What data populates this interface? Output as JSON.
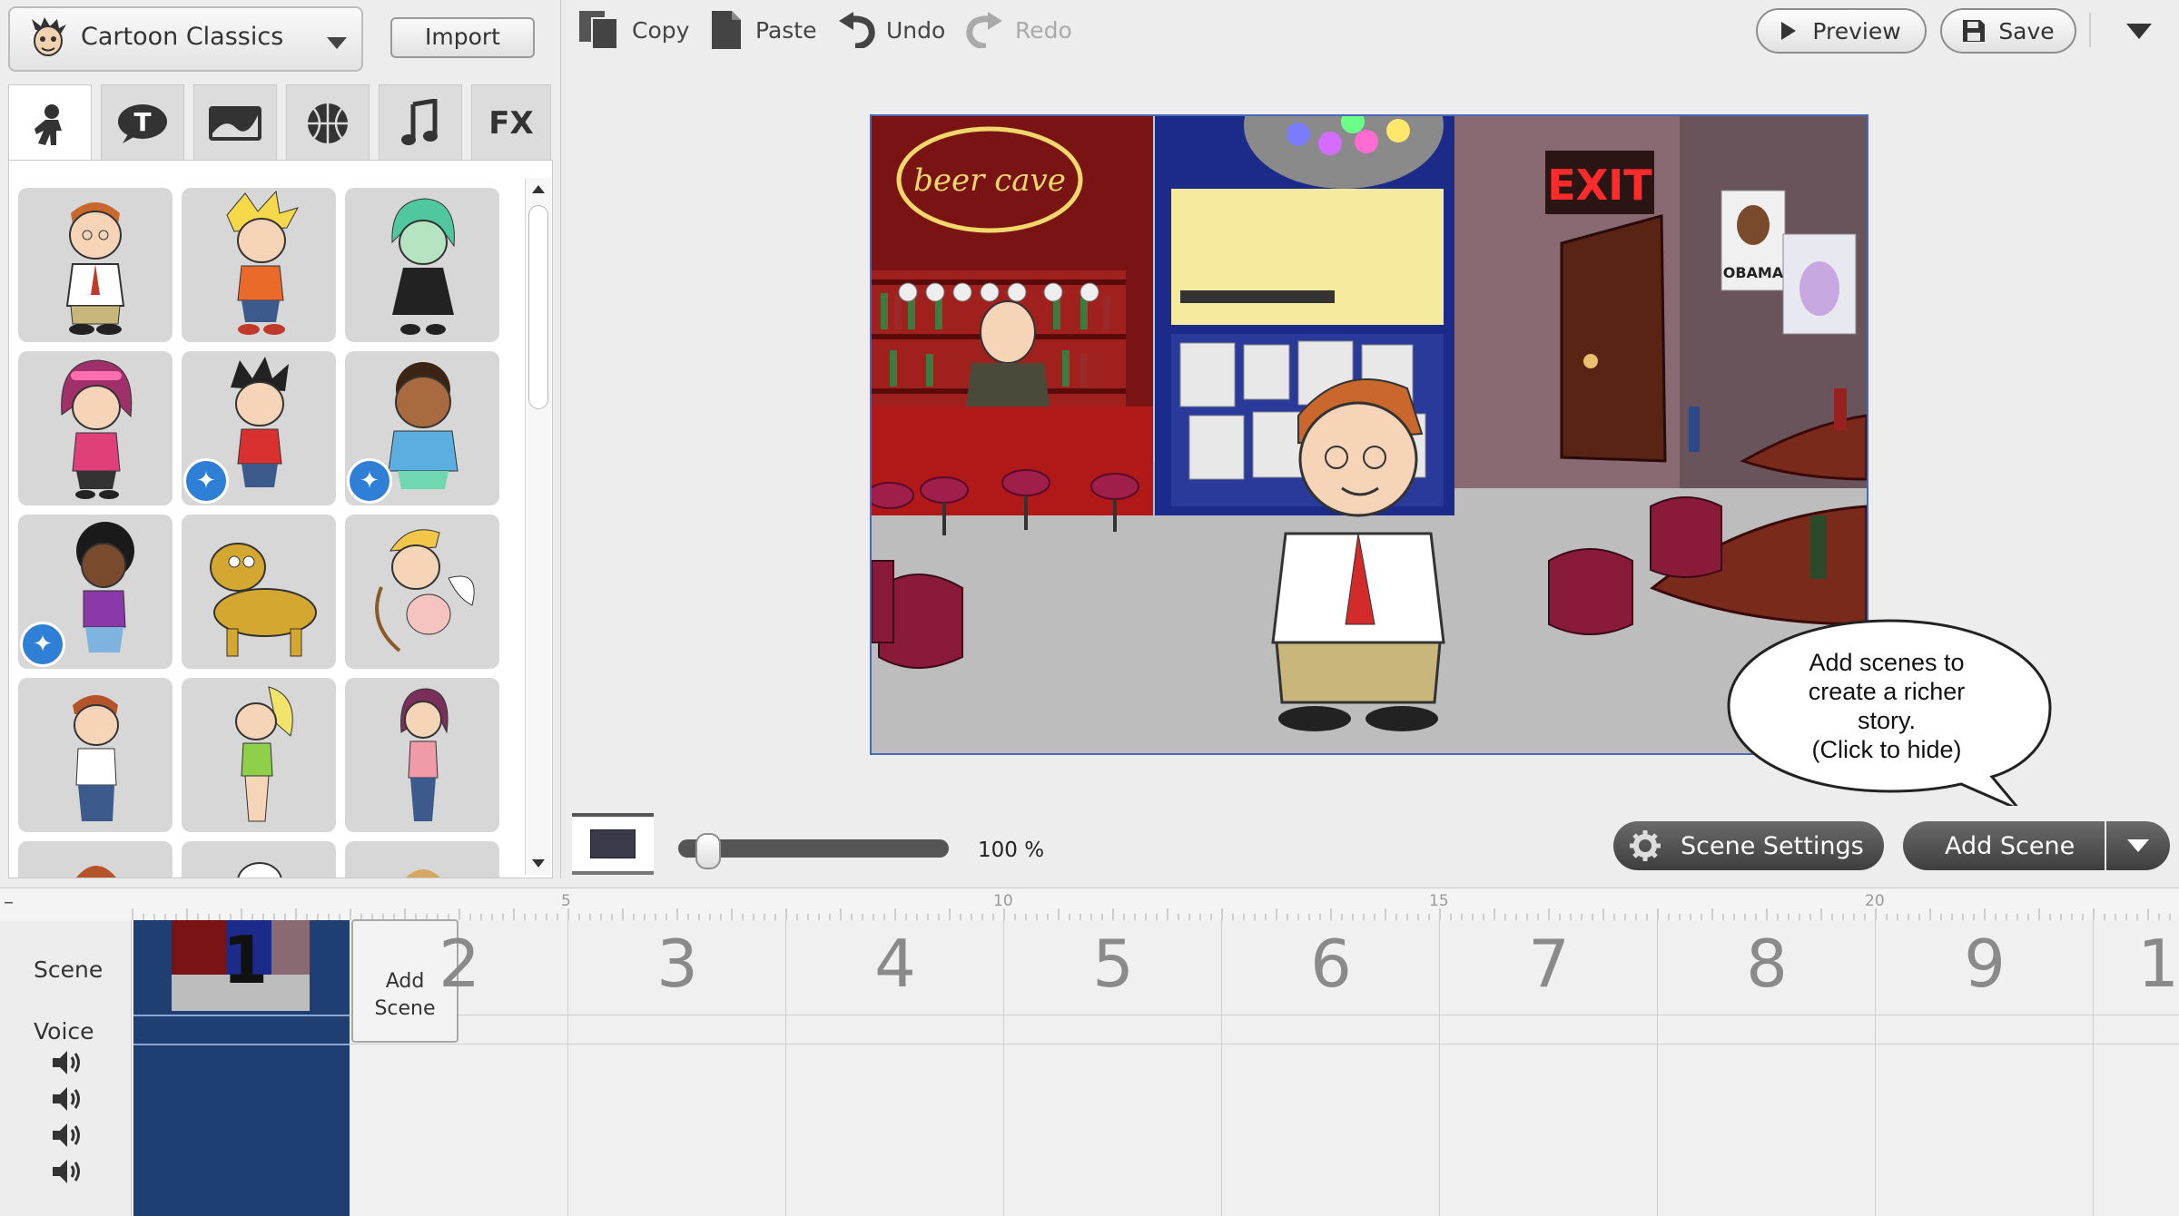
{
  "theme_selector": {
    "label": "Cartoon Classics"
  },
  "import_label": "Import",
  "asset_tabs": [
    {
      "name": "characters",
      "icon": "character-icon"
    },
    {
      "name": "text",
      "icon": "text-bubble-icon",
      "glyph": "T"
    },
    {
      "name": "backgrounds",
      "icon": "background-icon"
    },
    {
      "name": "props",
      "icon": "basketball-icon"
    },
    {
      "name": "music",
      "icon": "music-note-icon",
      "glyph": "♫"
    },
    {
      "name": "effects",
      "icon": "fx-icon",
      "glyph": "FX"
    }
  ],
  "toolbar": {
    "copy": "Copy",
    "paste": "Paste",
    "undo": "Undo",
    "redo": "Redo",
    "preview": "Preview",
    "save": "Save"
  },
  "stage": {
    "sign_text": "beer cave",
    "exit_text": "EXIT",
    "poster_text": "OBAMA"
  },
  "hint_bubble": {
    "line1": "Add scenes to",
    "line2": "create a richer",
    "line3": "story.",
    "line4": "(Click to hide)"
  },
  "zoom": {
    "label": "100 %",
    "value_percent": 100
  },
  "scene_settings_label": "Scene Settings",
  "add_scene_label": "Add Scene",
  "ruler_labels": [
    "5",
    "10",
    "15",
    "20"
  ],
  "timeline": {
    "scene_label": "Scene",
    "voice_label": "Voice",
    "current_scene_number": "1",
    "add_scene_line1": "Add",
    "add_scene_line2": "Scene",
    "scene_numbers": [
      "2",
      "3",
      "4",
      "5",
      "6",
      "7",
      "8",
      "9",
      "1"
    ]
  },
  "colors": {
    "accent_blue": "#2f7fd6",
    "timeline_scene": "#1f3f73",
    "dark_button": "#4a4a4a",
    "stage_border": "#4a69b8"
  }
}
